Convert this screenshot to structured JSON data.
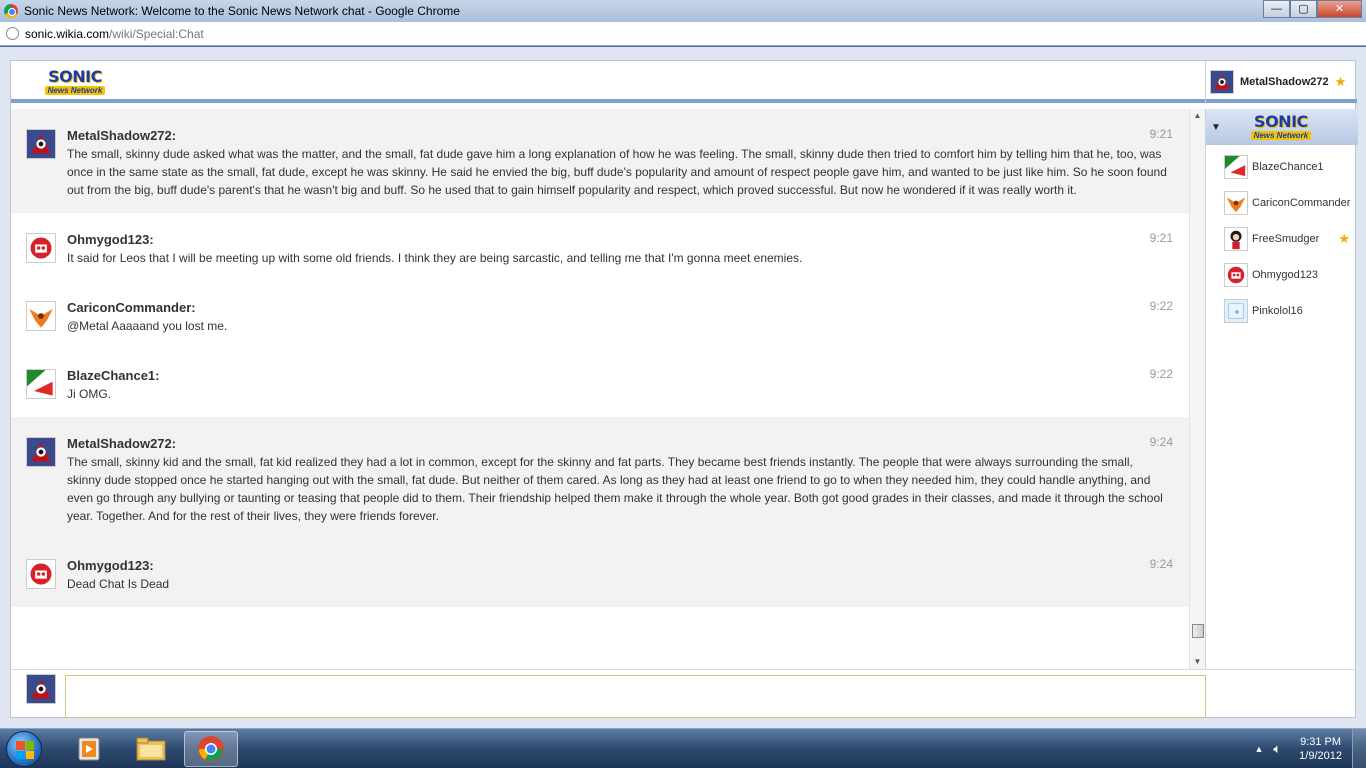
{
  "browser": {
    "title": "Sonic News Network: Welcome to the Sonic News Network chat - Google Chrome",
    "url_host": "sonic.wikia.com",
    "url_path": "/wiki/Special:Chat",
    "window_buttons": {
      "minimize": "—",
      "maximize": "▢",
      "close": "✕"
    }
  },
  "wiki": {
    "logo_line1": "SONIC",
    "logo_line2": "News Network"
  },
  "current_user": {
    "name": "MetalShadow272",
    "is_moderator": true
  },
  "messages": [
    {
      "user": "MetalShadow272:",
      "time": "9:21",
      "avatar": "metalshadow",
      "shaded": true,
      "text": "The small, skinny dude asked what was the matter, and the small, fat dude gave him a long explanation of how he was feeling. The small, skinny dude then tried to comfort him by telling him that he, too, was once in the same state as the small, fat dude, except he was skinny. He said he envied the big, buff dude's popularity and amount of respect people gave him, and wanted to be just like him. So he soon found out from the big, buff dude's parent's that he wasn't big and buff. So he used that to gain himself popularity and respect, which proved successful. But now he wondered if it was really worth it."
    },
    {
      "user": "Ohmygod123:",
      "time": "9:21",
      "avatar": "ohmygod",
      "shaded": false,
      "text": "It said for Leos that I will be meeting up with some old friends. I think they are being sarcastic, and telling me that I'm gonna meet enemies."
    },
    {
      "user": "CariconCommander:",
      "time": "9:22",
      "avatar": "caricon",
      "shaded": false,
      "text": "@Metal Aaaaand you lost me."
    },
    {
      "user": "BlazeChance1:",
      "time": "9:22",
      "avatar": "blaze",
      "shaded": false,
      "text": "Ji OMG."
    },
    {
      "user": "MetalShadow272:",
      "time": "9:24",
      "avatar": "metalshadow",
      "shaded": true,
      "text": "The small, skinny kid and the small, fat kid realized they had a lot in common, except for the skinny and fat parts. They became best friends instantly. The people that were always surrounding the small, skinny dude stopped once he started hanging out with the small, fat dude. But neither of them cared. As long as they had at least one friend to go to when they needed him, they could handle anything, and even go through any bullying or taunting or teasing that people did to them. Their friendship helped them make it through the whole year. Both got good grades in their classes, and made it through the school year. Together. And for the rest of their lives, they were friends forever."
    },
    {
      "user": "Ohmygod123:",
      "time": "9:24",
      "avatar": "ohmygod",
      "shaded": true,
      "text": "Dead Chat Is Dead"
    }
  ],
  "user_list": [
    {
      "name": "BlazeChance1",
      "avatar": "blaze",
      "star": false
    },
    {
      "name": "CariconCommander",
      "avatar": "caricon",
      "star": false
    },
    {
      "name": "FreeSmudger",
      "avatar": "freesmudger",
      "star": true
    },
    {
      "name": "Ohmygod123",
      "avatar": "ohmygod",
      "star": false
    },
    {
      "name": "Pinkolol16",
      "avatar": "pinkolol",
      "star": false
    }
  ],
  "input": {
    "value": "",
    "placeholder": ""
  },
  "taskbar": {
    "time": "9:31 PM",
    "date": "1/9/2012"
  },
  "colors": {
    "accent": "#7f9fd3",
    "star": "#f2a900",
    "input_border": "#d6c285"
  }
}
